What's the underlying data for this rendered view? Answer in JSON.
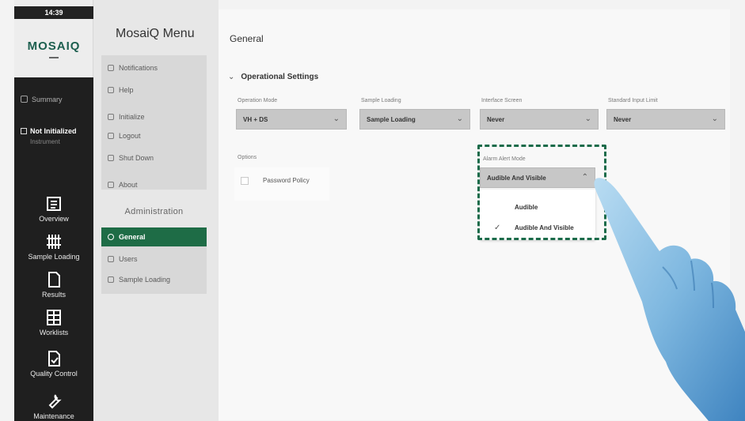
{
  "status": {
    "time": "14:39"
  },
  "brand": {
    "logo": "MOSAIQ",
    "accent_color": "#1e6c46",
    "highlight_color": "#1b6b4a"
  },
  "rail": {
    "summary": "Summary",
    "instrument_status": "Not Initialized",
    "instrument_sub": "Instrument",
    "items": [
      {
        "label": "Overview",
        "icon": "overview-icon"
      },
      {
        "label": "Sample Loading",
        "icon": "sample-loading-icon"
      },
      {
        "label": "Results",
        "icon": "results-icon"
      },
      {
        "label": "Worklists",
        "icon": "worklists-icon"
      },
      {
        "label": "Quality Control",
        "icon": "quality-control-icon"
      },
      {
        "label": "Maintenance",
        "icon": "maintenance-icon"
      }
    ]
  },
  "menu": {
    "title": "MosaiQ Menu",
    "items": [
      {
        "label": "Notifications",
        "icon": "bell-icon"
      },
      {
        "label": "Help",
        "icon": "help-icon"
      },
      {
        "label": "Initialize",
        "icon": "initialize-icon"
      },
      {
        "label": "Logout",
        "icon": "logout-icon"
      },
      {
        "label": "Shut Down",
        "icon": "power-icon"
      },
      {
        "label": "About",
        "icon": "info-icon"
      }
    ],
    "admin_header": "Administration",
    "admin_items": [
      {
        "label": "General",
        "icon": "gear-icon",
        "active": true
      },
      {
        "label": "Users",
        "icon": "users-icon",
        "active": false
      },
      {
        "label": "Sample Loading",
        "icon": "sample-loading-icon",
        "active": false
      }
    ]
  },
  "main": {
    "title": "General",
    "section": "Operational Settings",
    "fields": [
      {
        "label": "Operation Mode",
        "value": "VH + DS"
      },
      {
        "label": "Sample Loading",
        "value": "Sample Loading"
      },
      {
        "label": "Interface Screen",
        "value": "Never"
      },
      {
        "label": "Standard Input Limit",
        "value": "Never"
      }
    ],
    "options_label": "Options",
    "checkbox_label": "Password Policy",
    "alarm": {
      "label": "Alarm Alert Mode",
      "value": "Audible And Visible",
      "options": [
        "Audible",
        "Audible And Visible"
      ],
      "selected_index": 1
    }
  }
}
